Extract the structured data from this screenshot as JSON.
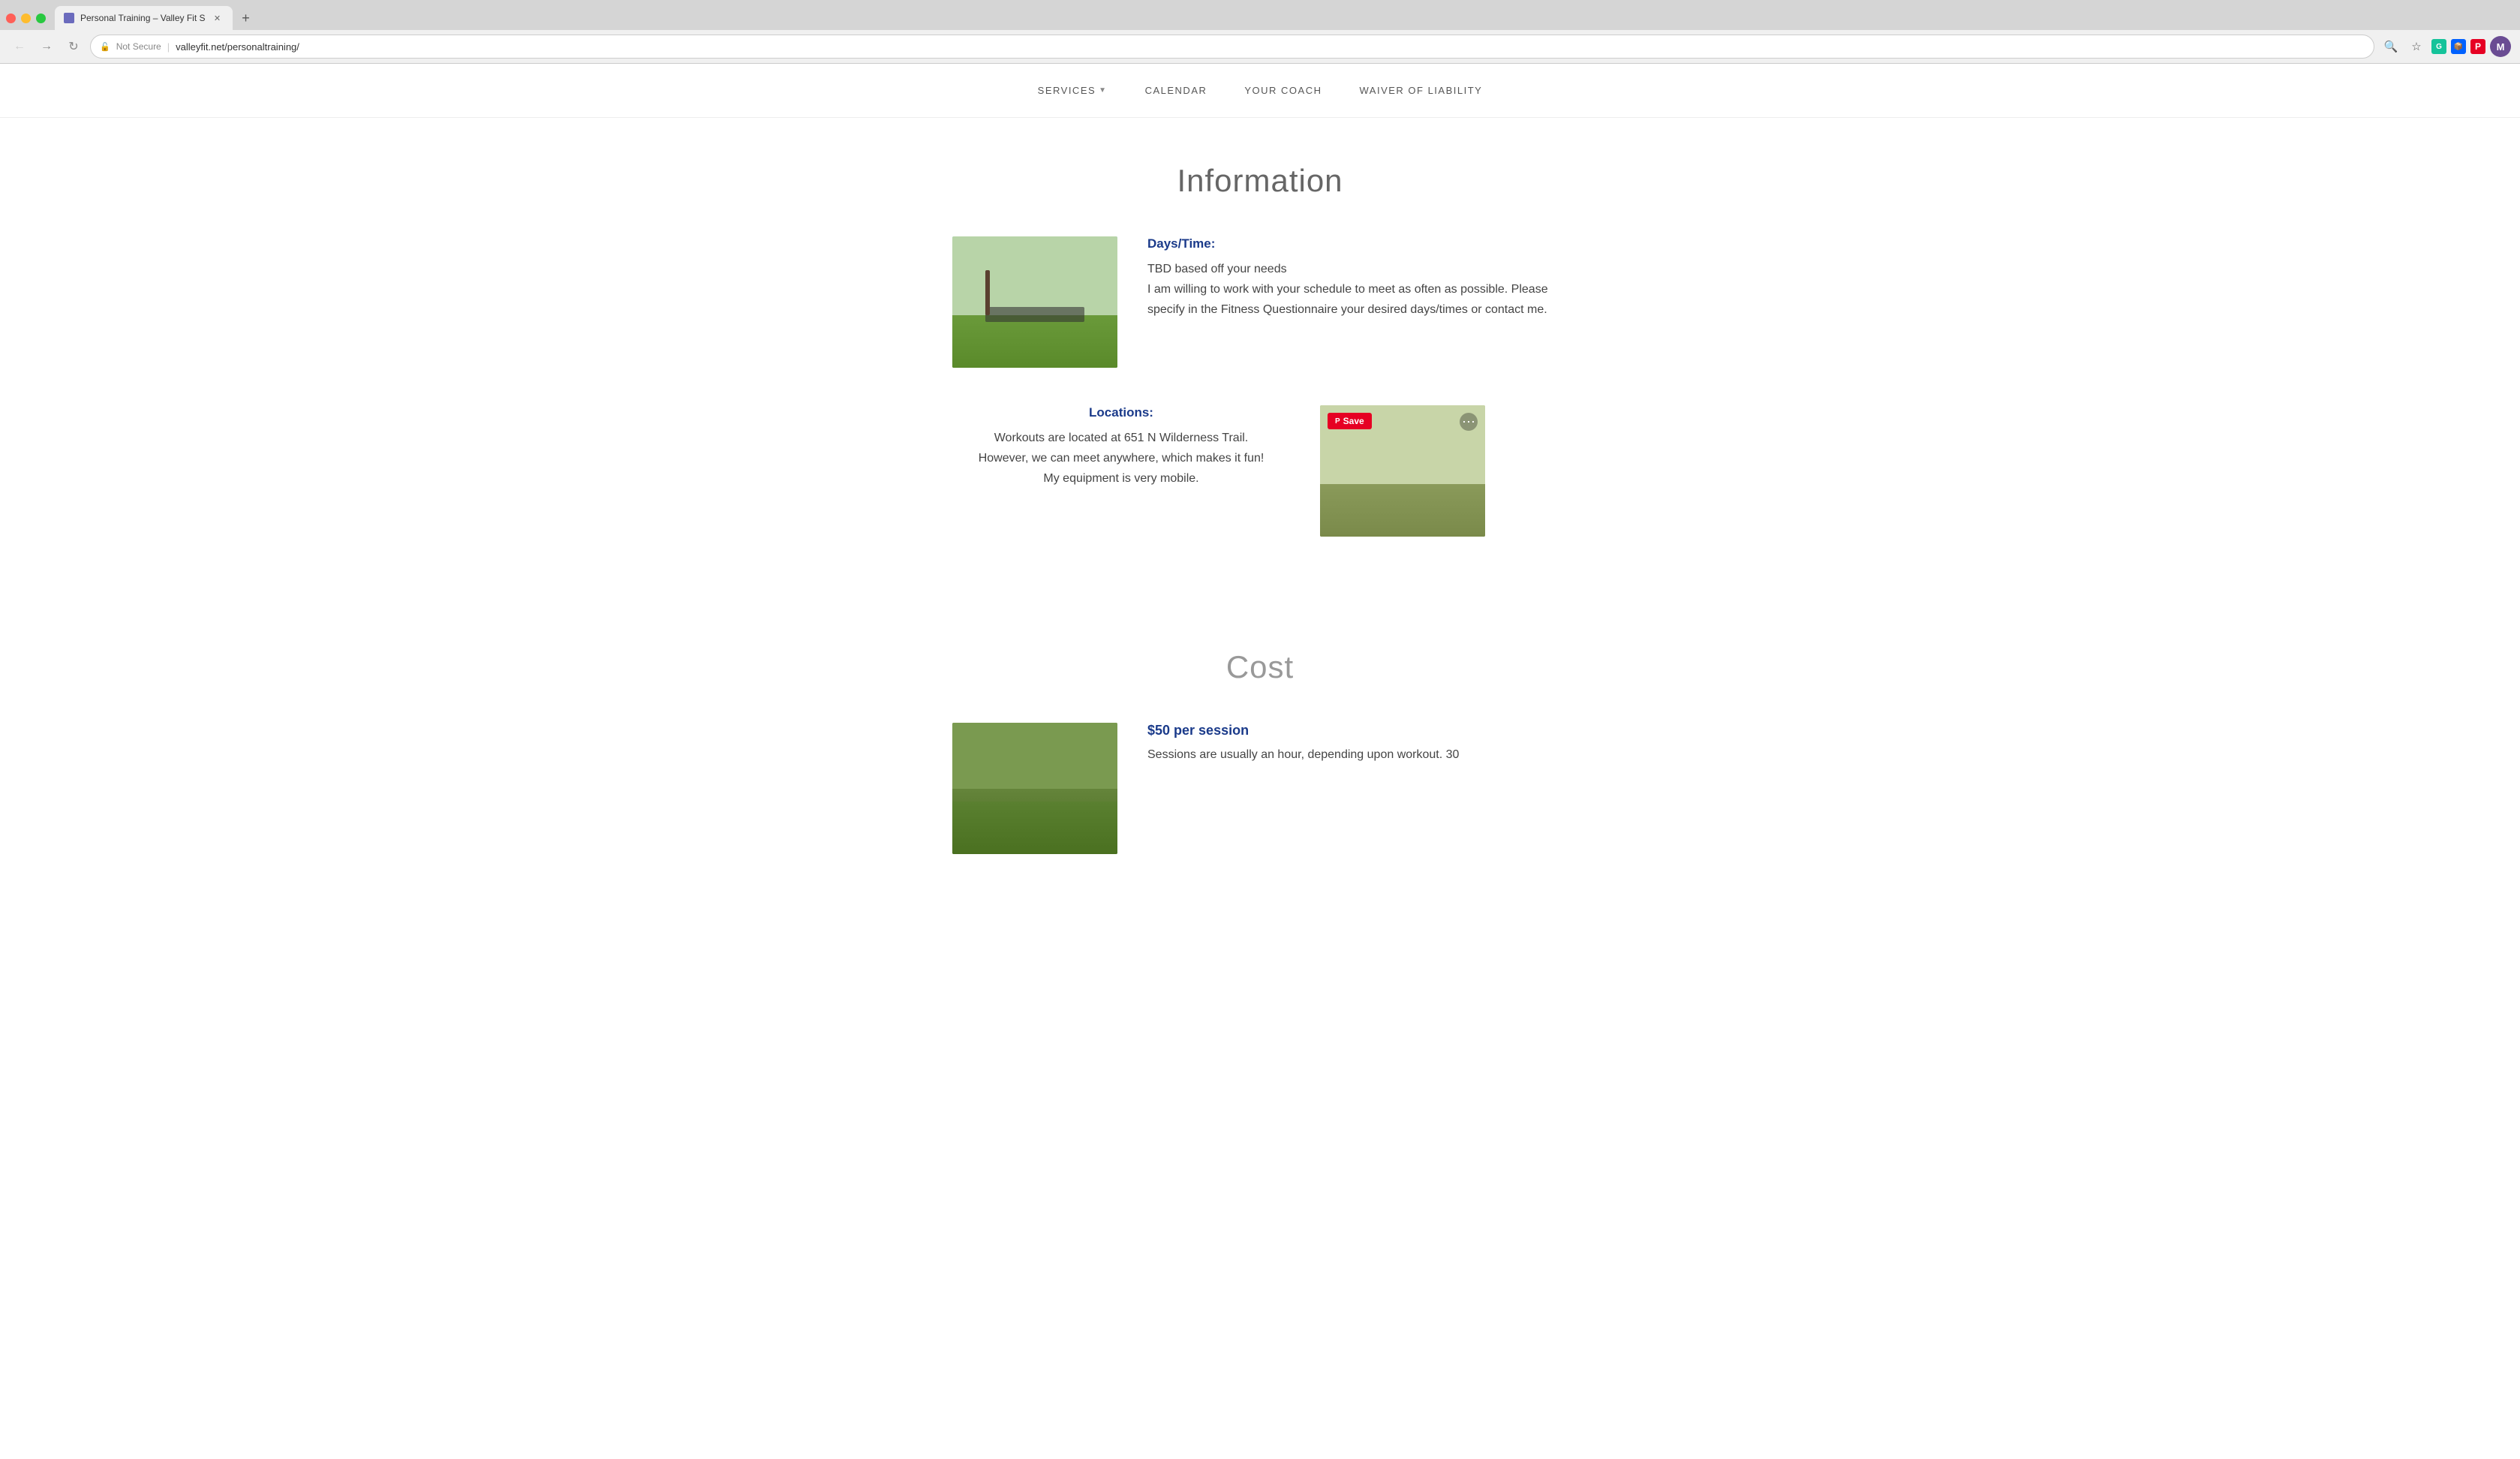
{
  "browser": {
    "tab_title": "Personal Training – Valley Fit S",
    "tab_favicon": "PF",
    "url_not_secure": "Not Secure",
    "url_separator": "|",
    "url": "valleyfit.net/personaltraining/",
    "profile_initial": "M",
    "new_tab_label": "+"
  },
  "nav": {
    "items": [
      {
        "label": "SERVICES",
        "has_dropdown": true
      },
      {
        "label": "CALENDAR",
        "has_dropdown": false
      },
      {
        "label": "YOUR COACH",
        "has_dropdown": false
      },
      {
        "label": "WAIVER OF LIABILITY",
        "has_dropdown": false
      }
    ]
  },
  "information": {
    "section_title": "Information",
    "days_time": {
      "label": "Days/Time:",
      "line1": "TBD based off your needs",
      "line2": "I am willing to work with your schedule to meet as often as possible. Please specify in the Fitness Questionnaire your desired days/times or contact me."
    },
    "locations": {
      "label": "Locations:",
      "line1": "Workouts are located at 651 N Wilderness Trail.",
      "line2": "However, we can meet anywhere, which makes it fun!",
      "line3": "My equipment is very mobile.",
      "save_button": "Save"
    }
  },
  "cost": {
    "section_title": "Cost",
    "per_session": {
      "label": "$50 per session",
      "line1": "Sessions are usually an hour, depending upon workout. 30"
    }
  }
}
